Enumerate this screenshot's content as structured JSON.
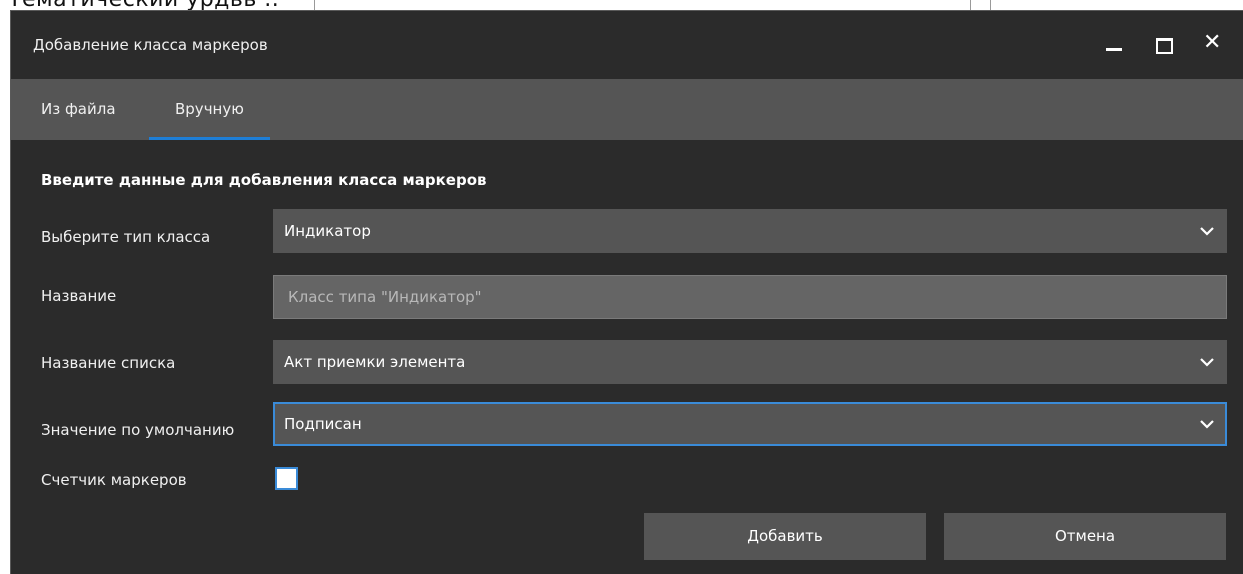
{
  "background_app": {
    "partial_text": "Тематический урдвь .."
  },
  "dialog": {
    "title": "Добавление класса маркеров",
    "window_controls": {
      "minimize_icon": "minimize-icon",
      "maximize_icon": "maximize-icon",
      "close_glyph": "✕"
    }
  },
  "tabs": [
    {
      "label": "Из файла",
      "active": false
    },
    {
      "label": "Вручную",
      "active": true
    }
  ],
  "form": {
    "heading": "Введите данные для добавления класса маркеров",
    "class_type": {
      "label": "Выберите тип класса",
      "value": "Индикатор"
    },
    "name": {
      "label": "Название",
      "placeholder": "Класс типа \"Индикатор\""
    },
    "list_name": {
      "label": "Название списка",
      "value": "Акт приемки элемента"
    },
    "default_value": {
      "label": "Значение по умолчанию",
      "value": "Подписан"
    },
    "marker_counter": {
      "label": "Счетчик маркеров",
      "checked": false
    }
  },
  "buttons": {
    "add": "Добавить",
    "cancel": "Отмена"
  },
  "colors": {
    "dialog_bg": "#2b2b2b",
    "tabbar_bg": "#555555",
    "accent": "#3a8bd8",
    "tab_underline": "#1e7ed6",
    "field_bg": "#555555",
    "text": "#ffffff"
  }
}
